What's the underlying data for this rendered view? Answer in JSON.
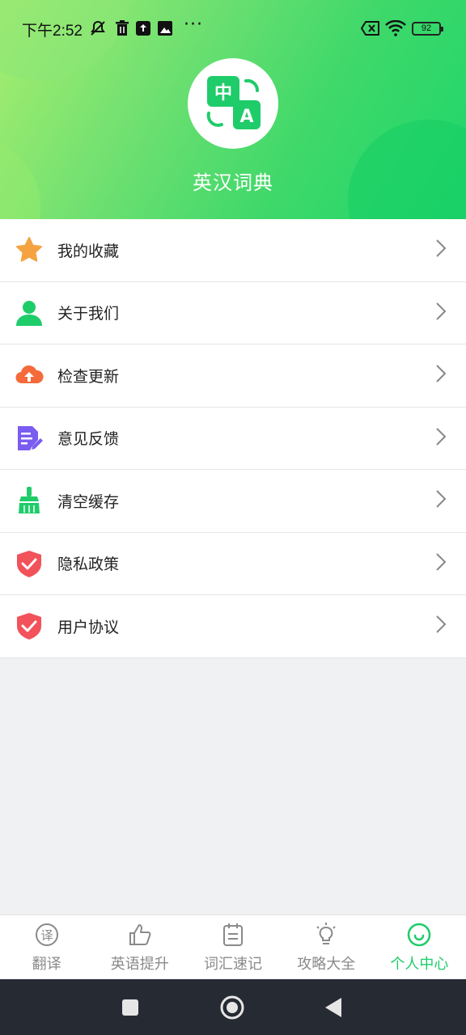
{
  "status_bar": {
    "time": "下午2:52",
    "more": "···",
    "battery": "92"
  },
  "header": {
    "app_title": "英汉词典",
    "logo_chars": {
      "zh": "中",
      "en": "A"
    }
  },
  "menu": [
    {
      "label": "我的收藏",
      "icon": "star-icon",
      "color": "#f4a340"
    },
    {
      "label": "关于我们",
      "icon": "user-icon",
      "color": "#1fcc6a"
    },
    {
      "label": "检查更新",
      "icon": "cloud-upload-icon",
      "color": "#f46a3a"
    },
    {
      "label": "意见反馈",
      "icon": "feedback-doc-icon",
      "color": "#7b5cf0"
    },
    {
      "label": "清空缓存",
      "icon": "broom-icon",
      "color": "#1fcc6a"
    },
    {
      "label": "隐私政策",
      "icon": "shield-check-icon",
      "color": "#f2525a"
    },
    {
      "label": "用户协议",
      "icon": "shield-check-icon",
      "color": "#f2525a"
    }
  ],
  "tabs": [
    {
      "label": "翻译",
      "icon": "translate-icon",
      "active": false
    },
    {
      "label": "英语提升",
      "icon": "thumbs-up-icon",
      "active": false
    },
    {
      "label": "词汇速记",
      "icon": "notepad-icon",
      "active": false
    },
    {
      "label": "攻略大全",
      "icon": "lightbulb-icon",
      "active": false
    },
    {
      "label": "个人中心",
      "icon": "smile-icon",
      "active": true
    }
  ],
  "colors": {
    "accent": "#1fcc6a",
    "tab_inactive": "#8a8a8a",
    "nav_bar": "#252a33"
  }
}
